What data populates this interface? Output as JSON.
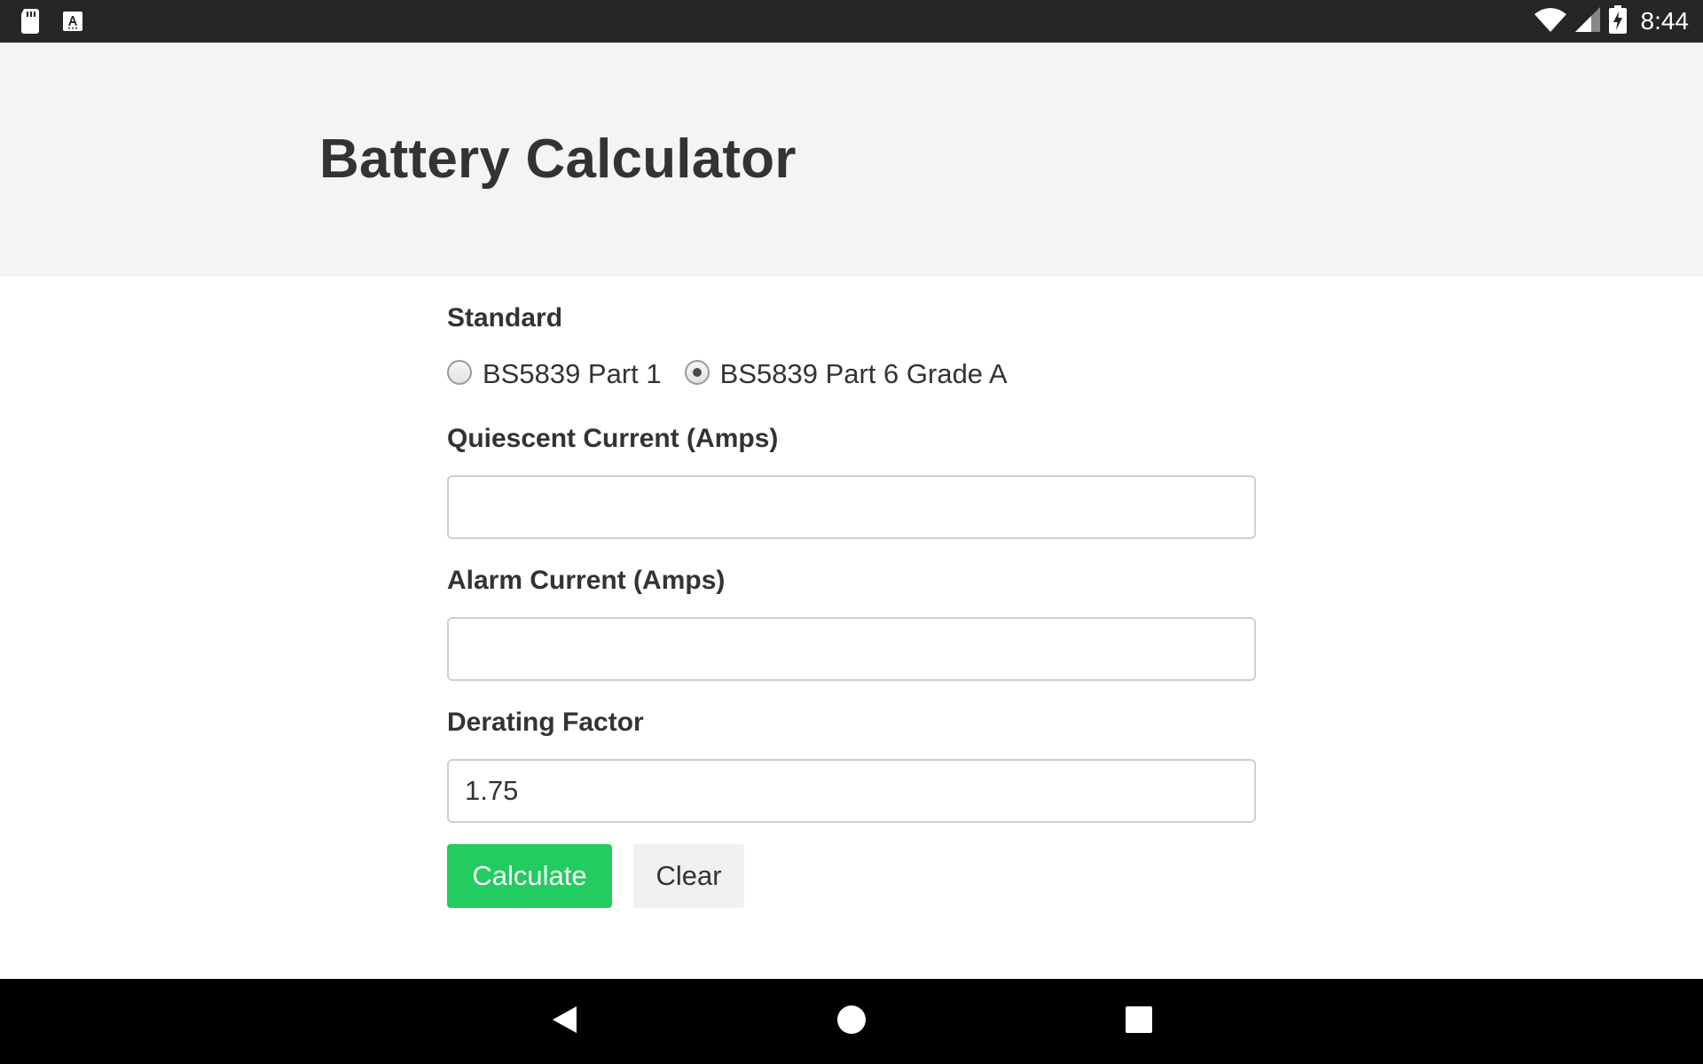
{
  "status_bar": {
    "time": "8:44",
    "left_icons": [
      "sd-card-icon",
      "font-a-icon"
    ],
    "right_icons": [
      "wifi-icon",
      "cellular-signal-icon",
      "battery-charging-icon"
    ]
  },
  "header": {
    "title": "Battery Calculator"
  },
  "form": {
    "standard": {
      "label": "Standard",
      "options": [
        {
          "label": "BS5839 Part 1",
          "checked": false
        },
        {
          "label": "BS5839 Part 6 Grade A",
          "checked": true
        }
      ]
    },
    "quiescent_current": {
      "label": "Quiescent Current (Amps)",
      "value": ""
    },
    "alarm_current": {
      "label": "Alarm Current (Amps)",
      "value": ""
    },
    "derating_factor": {
      "label": "Derating Factor",
      "value": "1.75"
    },
    "buttons": {
      "calculate": "Calculate",
      "clear": "Clear"
    }
  },
  "nav_bar": {
    "buttons": [
      "back-icon",
      "home-icon",
      "recents-icon"
    ]
  },
  "colors": {
    "status_bar_bg": "#262626",
    "header_bg": "#f4f4f4",
    "calculate_bg": "#22cc5e",
    "clear_bg": "#f0f0f0",
    "nav_bar_bg": "#000000"
  }
}
